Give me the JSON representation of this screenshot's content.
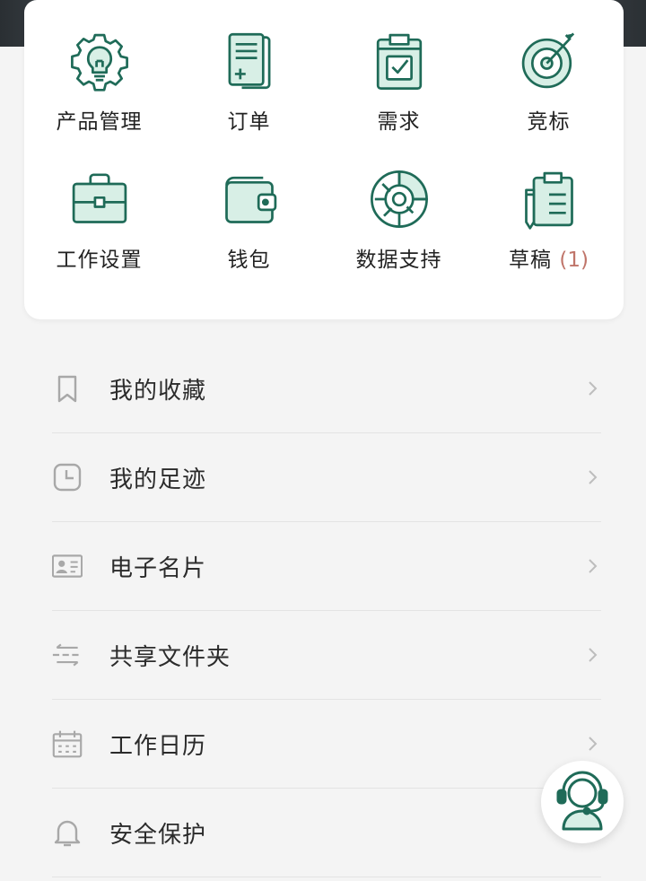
{
  "grid": {
    "items": [
      {
        "label": "产品管理",
        "icon": "gear-bulb-icon"
      },
      {
        "label": "订单",
        "icon": "order-document-icon"
      },
      {
        "label": "需求",
        "icon": "clipboard-check-icon"
      },
      {
        "label": "竞标",
        "icon": "target-icon"
      },
      {
        "label": "工作设置",
        "icon": "briefcase-icon"
      },
      {
        "label": "钱包",
        "icon": "wallet-icon"
      },
      {
        "label": "数据支持",
        "icon": "donut-chart-icon"
      },
      {
        "label": "草稿",
        "count": "(1)",
        "icon": "clipboard-draft-icon"
      }
    ]
  },
  "menu": {
    "items": [
      {
        "label": "我的收藏",
        "icon": "bookmark-icon"
      },
      {
        "label": "我的足迹",
        "icon": "clock-icon"
      },
      {
        "label": "电子名片",
        "icon": "id-card-icon"
      },
      {
        "label": "共享文件夹",
        "icon": "share-folder-icon"
      },
      {
        "label": "工作日历",
        "icon": "calendar-icon"
      },
      {
        "label": "安全保护",
        "icon": "bell-icon"
      }
    ]
  },
  "support": {
    "icon": "customer-service-icon"
  },
  "colors": {
    "accent": "#1f6b58",
    "accent_fill": "#d8efe6",
    "draft_count": "#c0756a",
    "menu_icon": "#a8a8a8"
  }
}
